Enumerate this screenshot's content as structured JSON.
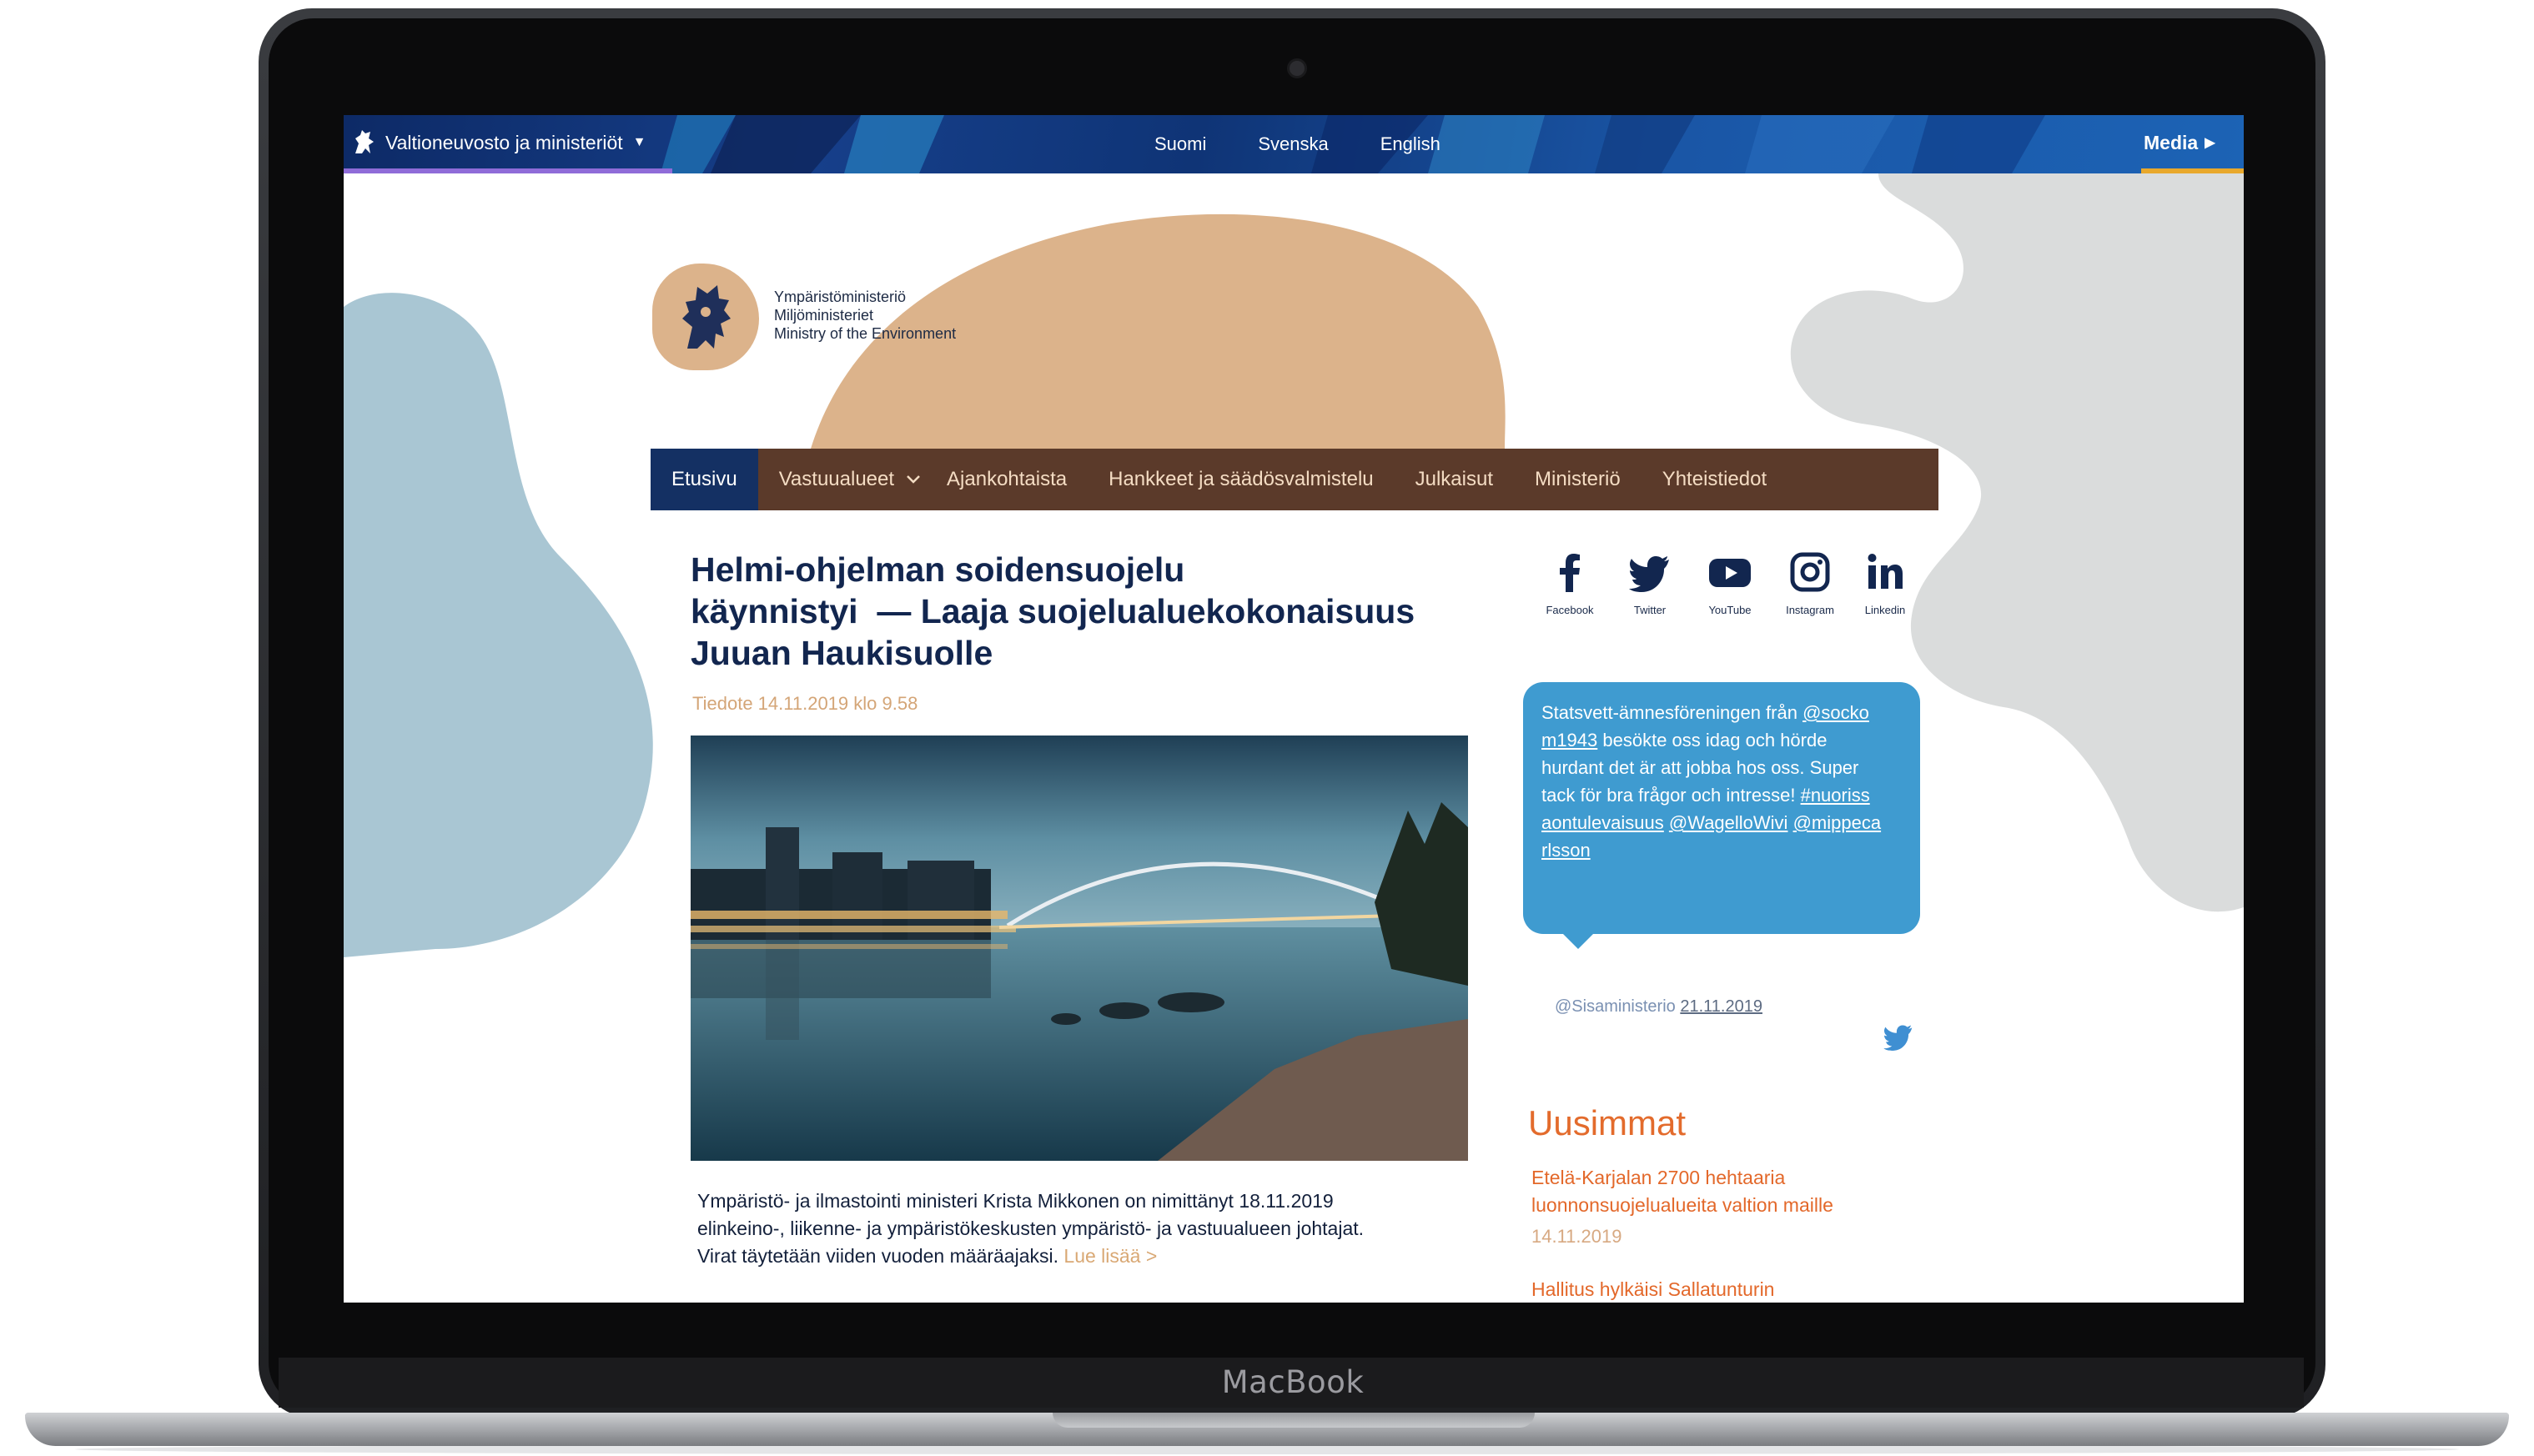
{
  "device": {
    "brand": "MacBook"
  },
  "topbar": {
    "gov_menu_label": "Valtioneuvosto ja ministeriöt",
    "languages": [
      "Suomi",
      "Svenska",
      "English"
    ],
    "media_label": "Media"
  },
  "logo": {
    "line1": "Ympäristöministeriö",
    "line2": "Miljöministeriet",
    "line3": "Ministry of the Environment"
  },
  "nav": {
    "items": [
      "Etusivu",
      "Vastuualueet",
      "Ajankohtaista",
      "Hankkeet ja säädösvalmistelu",
      "Julkaisut",
      "Ministeriö",
      "Yhteistiedot"
    ],
    "active": "Etusivu"
  },
  "article": {
    "headline_line1": "Helmi-ohjelman soidensuojelu",
    "headline_line2": "käynnistyi  — Laaja suojelualuekokonaisuus",
    "headline_line3": "Juuan Haukisuolle",
    "date": "Tiedote 14.11.2019 klo 9.58",
    "lead_line1": "Ympäristö- ja ilmastointi ministeri Krista Mikkonen on nimittänyt 18.11.2019",
    "lead_line2": "elinkeino-, liikenne- ja ympäristökeskusten ympäristö- ja vastuualueen johtajat.",
    "lead_line3": "Virat täytetään viiden vuoden määräajaksi.",
    "read_more": "Lue lisää >"
  },
  "social": {
    "items": [
      {
        "label": "Facebook",
        "icon": "facebook-icon"
      },
      {
        "label": "Twitter",
        "icon": "twitter-icon"
      },
      {
        "label": "YouTube",
        "icon": "youtube-icon"
      },
      {
        "label": "Instagram",
        "icon": "instagram-icon"
      },
      {
        "label": "Linkedin",
        "icon": "linkedin-icon"
      }
    ]
  },
  "tweet": {
    "line1a": "Statsvett-ämnesföreningen från ",
    "line1b": "@socko",
    "line2a": "m1943",
    "line2b": " besökte oss idag och hörde",
    "line3": "hurdant det är att jobba hos oss. Super",
    "line4a": "tack för bra frågor och intresse! ",
    "line4b": "#nuoriss",
    "line5a": "aontulevaisuus",
    "line5b": "@WagelloWivi",
    "line5c": "@mippeca",
    "line6": "rlsson",
    "handle": "@Sisaministerio",
    "date": "21.11.2019"
  },
  "latest": {
    "title": "Uusimmat",
    "items": [
      {
        "line1": "Etelä-Karjalan 2700 hehtaaria",
        "line2": "luonnonsuojelualueita valtion maille",
        "date": "14.11.2019"
      },
      {
        "line1": "Hallitus hylkäisi Sallatunturin"
      }
    ]
  },
  "colors": {
    "nav_bg": "#5b3a2a",
    "nav_active": "#143063",
    "headline": "#12264f",
    "accent_orange": "#e36b2c",
    "tweet_bg": "#3f9bd0",
    "blob_blue": "#a9c6d3",
    "blob_tan": "#dcb38b",
    "blob_grey": "#dadcdc"
  }
}
